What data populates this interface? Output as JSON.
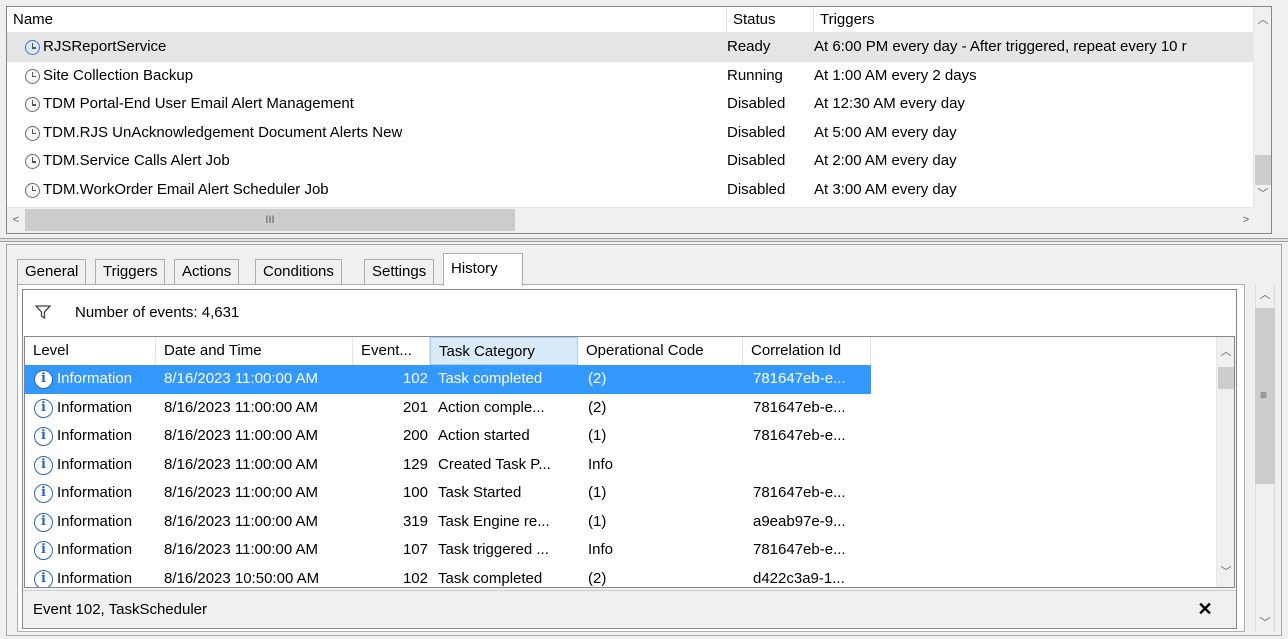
{
  "task_list": {
    "columns": [
      "Name",
      "Status",
      "Triggers"
    ],
    "rows": [
      {
        "name": "RJSReportService",
        "status": "Ready",
        "triggers": "At 6:00 PM every day - After triggered, repeat every 10 r",
        "selected": true
      },
      {
        "name": "Site Collection Backup",
        "status": "Running",
        "triggers": "At 1:00 AM every 2 days"
      },
      {
        "name": "TDM Portal-End User Email Alert Management",
        "status": "Disabled",
        "triggers": "At 12:30 AM every day"
      },
      {
        "name": "TDM.RJS UnAcknowledgement Document Alerts New",
        "status": "Disabled",
        "triggers": "At 5:00 AM every day"
      },
      {
        "name": "TDM.Service Calls Alert Job",
        "status": "Disabled",
        "triggers": "At 2:00 AM every day"
      },
      {
        "name": "TDM.WorkOrder Email Alert Scheduler Job",
        "status": "Disabled",
        "triggers": "At 3:00 AM every day"
      }
    ],
    "hscroll_grip": "III"
  },
  "tabs": [
    "General",
    "Triggers",
    "Actions",
    "Conditions",
    "Settings",
    "History"
  ],
  "active_tab": "History",
  "history": {
    "events_label": "Number of events: 4,631",
    "columns": [
      "Level",
      "Date and Time",
      "Event...",
      "Task Category",
      "Operational Code",
      "Correlation Id"
    ],
    "sorted_column": "Task Category",
    "rows": [
      {
        "level": "Information",
        "date": "8/16/2023 11:00:00 AM",
        "event": "102",
        "category": "Task completed",
        "opcode": "(2)",
        "corr": "781647eb-e...",
        "selected": true
      },
      {
        "level": "Information",
        "date": "8/16/2023 11:00:00 AM",
        "event": "201",
        "category": "Action comple...",
        "opcode": "(2)",
        "corr": "781647eb-e..."
      },
      {
        "level": "Information",
        "date": "8/16/2023 11:00:00 AM",
        "event": "200",
        "category": "Action started",
        "opcode": "(1)",
        "corr": "781647eb-e..."
      },
      {
        "level": "Information",
        "date": "8/16/2023 11:00:00 AM",
        "event": "129",
        "category": "Created Task P...",
        "opcode": "Info",
        "corr": ""
      },
      {
        "level": "Information",
        "date": "8/16/2023 11:00:00 AM",
        "event": "100",
        "category": "Task Started",
        "opcode": "(1)",
        "corr": "781647eb-e..."
      },
      {
        "level": "Information",
        "date": "8/16/2023 11:00:00 AM",
        "event": "319",
        "category": "Task Engine re...",
        "opcode": "(1)",
        "corr": "a9eab97e-9..."
      },
      {
        "level": "Information",
        "date": "8/16/2023 11:00:00 AM",
        "event": "107",
        "category": "Task triggered ...",
        "opcode": "Info",
        "corr": "781647eb-e..."
      },
      {
        "level": "Information",
        "date": "8/16/2023 10:50:00 AM",
        "event": "102",
        "category": "Task completed",
        "opcode": "(2)",
        "corr": "d422c3a9-1..."
      }
    ],
    "details_title": "Event 102, TaskScheduler",
    "details_close": "✕"
  },
  "colors": {
    "selection": "#3399ff",
    "sorted_header": "#d9ebf9",
    "info_icon": "#2b66b8"
  }
}
